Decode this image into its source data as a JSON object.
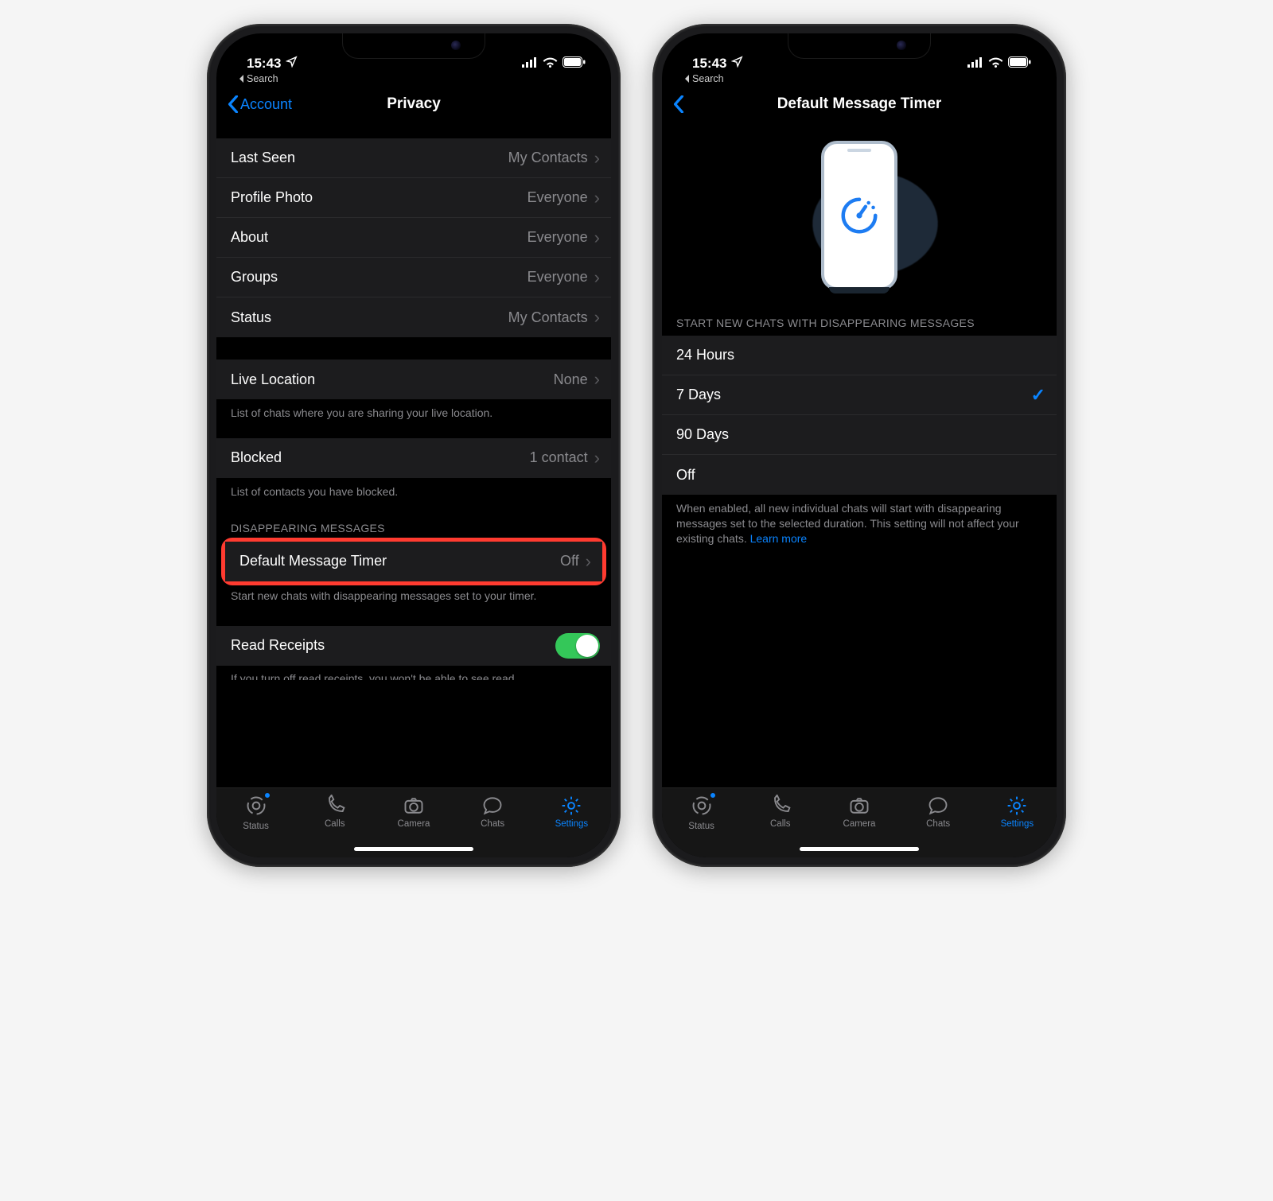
{
  "statusbar": {
    "time": "15:43",
    "breadcrumb": "Search"
  },
  "left": {
    "nav": {
      "back": "Account",
      "title": "Privacy"
    },
    "grp1": [
      {
        "label": "Last Seen",
        "value": "My Contacts"
      },
      {
        "label": "Profile Photo",
        "value": "Everyone"
      },
      {
        "label": "About",
        "value": "Everyone"
      },
      {
        "label": "Groups",
        "value": "Everyone"
      },
      {
        "label": "Status",
        "value": "My Contacts"
      }
    ],
    "live": {
      "label": "Live Location",
      "value": "None",
      "footer": "List of chats where you are sharing your live location."
    },
    "blocked": {
      "label": "Blocked",
      "value": "1 contact",
      "footer": "List of contacts you have blocked."
    },
    "disappearing": {
      "header": "DISAPPEARING MESSAGES",
      "row": {
        "label": "Default Message Timer",
        "value": "Off"
      },
      "footer": "Start new chats with disappearing messages set to your timer."
    },
    "receipts": {
      "label": "Read Receipts",
      "on": true,
      "cutoff": "If you turn off read receipts, you won't be able to see read"
    }
  },
  "right": {
    "nav": {
      "title": "Default Message Timer"
    },
    "options": {
      "header": "START NEW CHATS WITH DISAPPEARING MESSAGES",
      "items": [
        "24 Hours",
        "7 Days",
        "90 Days",
        "Off"
      ],
      "selected": "7 Days",
      "footer_a": "When enabled, all new individual chats will start with disappearing messages set to the selected duration. This setting will not affect your existing chats. ",
      "learn": "Learn more"
    }
  },
  "tabs": [
    "Status",
    "Calls",
    "Camera",
    "Chats",
    "Settings"
  ],
  "active_tab": "Settings"
}
